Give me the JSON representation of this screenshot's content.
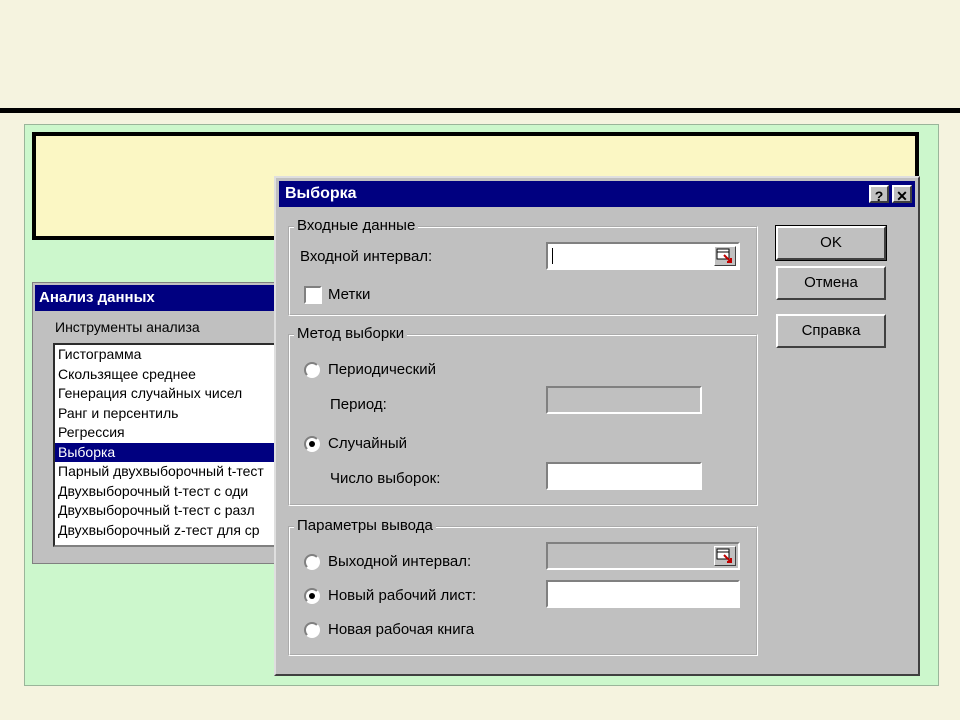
{
  "background_dialog": {
    "title": "Анализ данных",
    "tools_label": "Инструменты анализа",
    "tools": [
      "Гистограмма",
      "Скользящее среднее",
      "Генерация случайных чисел",
      "Ранг и персентиль",
      "Регрессия",
      "Выборка",
      "Парный двухвыборочный t-тест",
      "Двухвыборочный t-тест с оди",
      "Двухвыборочный t-тест с разл",
      "Двухвыборочный z-тест для ср"
    ],
    "selected_index": 5
  },
  "dialog": {
    "title": "Выборка",
    "help_icon": "?",
    "close_icon": "✕",
    "input_group": {
      "label": "Входные данные",
      "input_range_label": "Входной интервал:",
      "input_range_value": "",
      "labels_checkbox": "Метки",
      "labels_checked": false
    },
    "method_group": {
      "label": "Метод выборки",
      "periodic_label": "Периодический",
      "period_label": "Период:",
      "period_value": "",
      "random_label": "Случайный",
      "samples_label": "Число выборок:",
      "samples_value": "",
      "selected": "random"
    },
    "output_group": {
      "label": "Параметры вывода",
      "output_range_label": "Выходной интервал:",
      "output_range_value": "",
      "new_sheet_label": "Новый рабочий лист:",
      "new_sheet_value": "",
      "new_book_label": "Новая рабочая книга",
      "selected": "new_sheet"
    },
    "buttons": {
      "ok": "OK",
      "cancel": "Отмена",
      "help": "Справка"
    }
  },
  "colors": {
    "title_bar": "#000080",
    "dialog_face": "#c0c0c0",
    "green_panel": "#ccf7cc",
    "yellow_box": "#fbf7c4",
    "slide_bg": "#f5f3df"
  }
}
